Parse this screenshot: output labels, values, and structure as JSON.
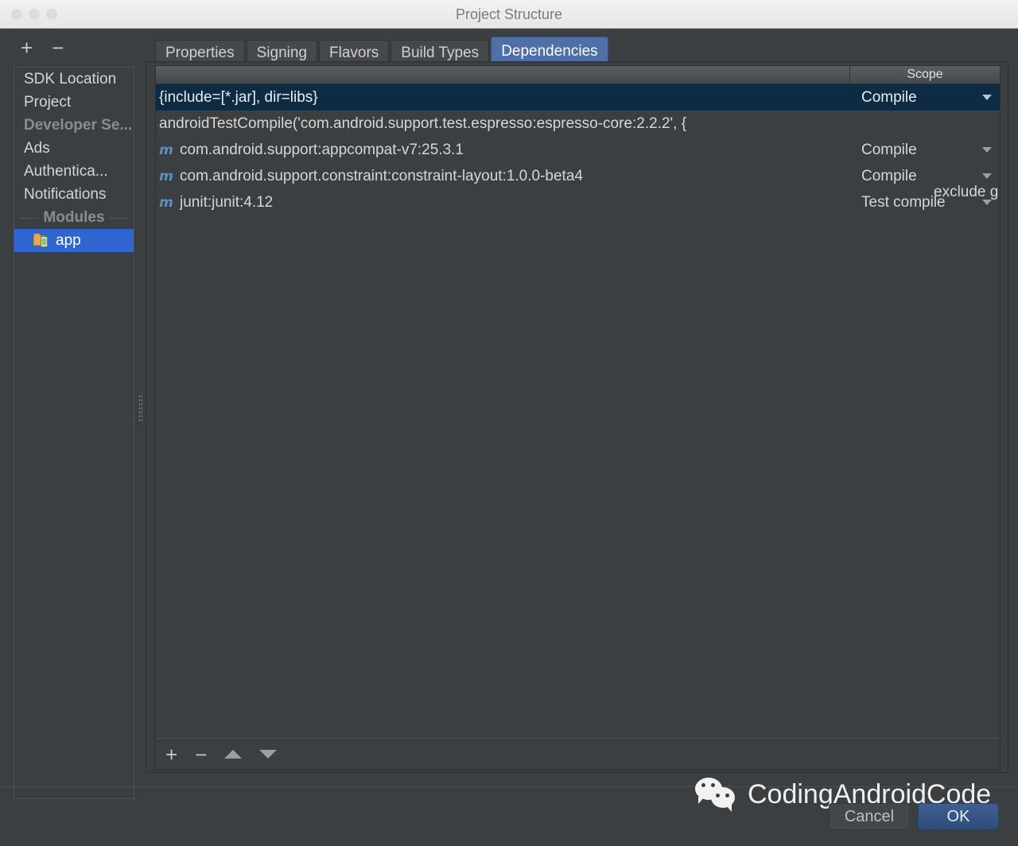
{
  "window": {
    "title": "Project Structure",
    "traffic_lights": [
      "close-button",
      "minimize-button",
      "zoom-button"
    ]
  },
  "sidebar": {
    "add_label": "+",
    "remove_label": "−",
    "items": [
      {
        "label": "SDK Location",
        "type": "item"
      },
      {
        "label": "Project",
        "type": "item"
      },
      {
        "label": "Developer Se...",
        "type": "group"
      },
      {
        "label": "Ads",
        "type": "item"
      },
      {
        "label": "Authentica...",
        "type": "item"
      },
      {
        "label": "Notifications",
        "type": "item"
      },
      {
        "label": "Modules",
        "type": "group-center"
      },
      {
        "label": "app",
        "type": "module",
        "selected": true
      }
    ],
    "selected_color": "#2f65d0"
  },
  "tabs": [
    {
      "label": "Properties",
      "active": false
    },
    {
      "label": "Signing",
      "active": false
    },
    {
      "label": "Flavors",
      "active": false
    },
    {
      "label": "Build Types",
      "active": false
    },
    {
      "label": "Dependencies",
      "active": true
    }
  ],
  "table": {
    "columns": [
      "",
      "Scope"
    ],
    "scope_header": "Scope",
    "rows": [
      {
        "icon": "",
        "name": "{include=[*.jar], dir=libs}",
        "scope": "Compile",
        "selected": true,
        "has_caret": true,
        "overflow": ""
      },
      {
        "icon": "",
        "name": "androidTestCompile('com.android.support.test.espresso:espresso-core:2.2.2', {",
        "scope": "",
        "selected": false,
        "has_caret": false,
        "overflow": "exclude g"
      },
      {
        "icon": "m",
        "name": "com.android.support:appcompat-v7:25.3.1",
        "scope": "Compile",
        "selected": false,
        "has_caret": true,
        "overflow": ""
      },
      {
        "icon": "m",
        "name": "com.android.support.constraint:constraint-layout:1.0.0-beta4",
        "scope": "Compile",
        "selected": false,
        "has_caret": true,
        "overflow": ""
      },
      {
        "icon": "m",
        "name": "junit:junit:4.12",
        "scope": "Test compile",
        "selected": false,
        "has_caret": true,
        "overflow": ""
      }
    ]
  },
  "panel_toolbar": {
    "add_label": "+",
    "remove_label": "−",
    "move_up": "move-up-arrow",
    "move_down": "move-down-arrow"
  },
  "footer": {
    "cancel_label": "Cancel",
    "ok_label": "OK",
    "ok_color": "#3d5f91"
  },
  "watermark": {
    "text": "CodingAndroidCode",
    "icon": "wechat-icon"
  }
}
